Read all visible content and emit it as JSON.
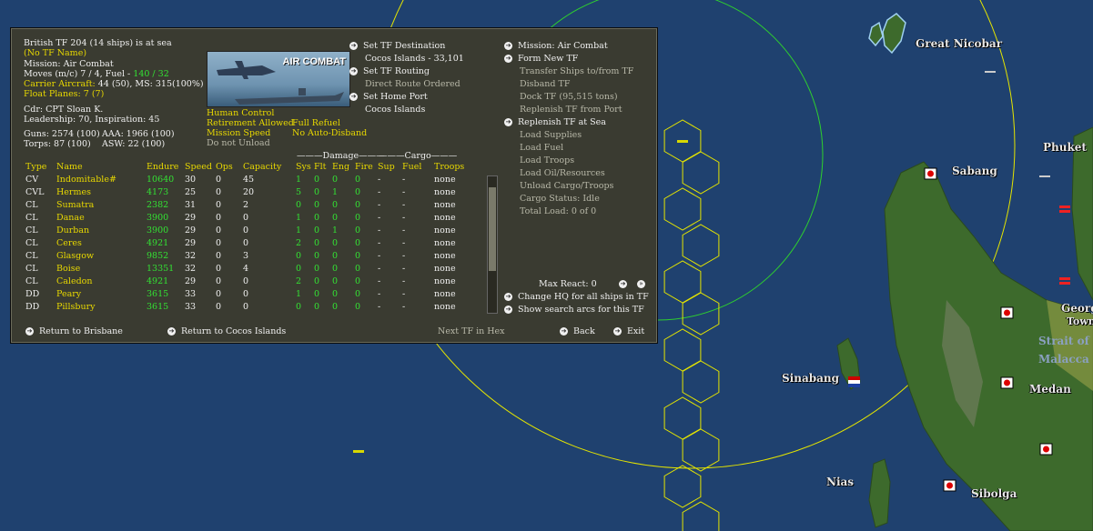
{
  "map": {
    "labels": {
      "great_nicobar": "Great Nicobar",
      "phuket": "Phuket",
      "sabang": "Sabang",
      "sinabang": "Sinabang",
      "medan": "Medan",
      "nias": "Nias",
      "sibolga": "Sibolga",
      "strait_line1": "Strait of",
      "strait_line2": "Malacca",
      "george_line1": "Georg",
      "george_line2": "Town"
    }
  },
  "panel": {
    "header": {
      "title": "British TF 204 (14 ships) is at sea",
      "tf_name": "(No TF Name)",
      "mission": "Mission:  Air Combat",
      "moves_prefix": "Moves (m/c)  7 / 4, Fuel - ",
      "fuel": "140 / 32",
      "carrier_label": "Carrier Aircraft:",
      "carrier_value": " 44 (50),  MS: 315(100%)",
      "float_label": "Float Planes:",
      "float_value": " 7 (7)",
      "cdr": "Cdr: CPT  Sloan K.",
      "leadership": "Leadership: 70, Inspiration: 45",
      "guns": "Guns: 2574 (100)",
      "aaa": "AAA: 1966 (100)",
      "torps": "Torps: 87 (100)",
      "asw": "ASW: 22 (100)"
    },
    "image_caption": "AIR COMBAT",
    "options": {
      "human_control": "Human Control",
      "retirement": "Retirement Allowed",
      "full_refuel": "Full Refuel",
      "mission_speed": "Mission Speed",
      "no_auto_disband": "No Auto-Disband",
      "do_not_unload": "Do not Unload"
    },
    "mid_menu": {
      "set_destination": "Set TF Destination",
      "destination_value": "Cocos Islands - 33,101",
      "set_routing": "Set TF Routing",
      "direct_route": "Direct Route Ordered",
      "set_home_port": "Set Home Port",
      "home_port_value": "Cocos Islands"
    },
    "right_menu": {
      "mission": "Mission: Air Combat",
      "form_new": "Form New TF",
      "transfer": "Transfer Ships to/from TF",
      "disband": "Disband TF",
      "dock": "Dock TF (95,515 tons)",
      "replenish_port": "Replenish TF from Port",
      "replenish_sea": "Replenish TF at Sea",
      "load_supplies": "Load Supplies",
      "load_fuel": "Load Fuel",
      "load_troops": "Load Troops",
      "load_oil": "Load Oil/Resources",
      "unload": "Unload Cargo/Troops",
      "cargo_status": "Cargo Status: Idle",
      "total_load": "Total Load: 0 of 0",
      "max_react": "Max React: 0",
      "change_hq": "Change HQ for all ships in TF",
      "show_arcs": "Show search arcs for this TF"
    },
    "table": {
      "group_damage": "———Damage———",
      "group_cargo": "———Cargo———",
      "headers": [
        "Type",
        "Name",
        "Endure",
        "Speed",
        "Ops",
        "Capacity",
        "Sys",
        "Flt",
        "Eng",
        "Fire",
        "Sup",
        "Fuel",
        "Troops"
      ],
      "rows": [
        [
          "CV",
          "Indomitable#",
          "10640",
          "30",
          "0",
          "45",
          "1",
          "0",
          "0",
          "0",
          "-",
          "-",
          "none"
        ],
        [
          "CVL",
          "Hermes",
          "4173",
          "25",
          "0",
          "20",
          "5",
          "0",
          "1",
          "0",
          "-",
          "-",
          "none"
        ],
        [
          "CL",
          "Sumatra",
          "2382",
          "31",
          "0",
          "2",
          "0",
          "0",
          "0",
          "0",
          "-",
          "-",
          "none"
        ],
        [
          "CL",
          "Danae",
          "3900",
          "29",
          "0",
          "0",
          "1",
          "0",
          "0",
          "0",
          "-",
          "-",
          "none"
        ],
        [
          "CL",
          "Durban",
          "3900",
          "29",
          "0",
          "0",
          "1",
          "0",
          "1",
          "0",
          "-",
          "-",
          "none"
        ],
        [
          "CL",
          "Ceres",
          "4921",
          "29",
          "0",
          "0",
          "2",
          "0",
          "0",
          "0",
          "-",
          "-",
          "none"
        ],
        [
          "CL",
          "Glasgow",
          "9852",
          "32",
          "0",
          "3",
          "0",
          "0",
          "0",
          "0",
          "-",
          "-",
          "none"
        ],
        [
          "CL",
          "Boise",
          "13351",
          "32",
          "0",
          "4",
          "0",
          "0",
          "0",
          "0",
          "-",
          "-",
          "none"
        ],
        [
          "CL",
          "Caledon",
          "4921",
          "29",
          "0",
          "0",
          "2",
          "0",
          "0",
          "0",
          "-",
          "-",
          "none"
        ],
        [
          "DD",
          "Peary",
          "3615",
          "33",
          "0",
          "0",
          "1",
          "0",
          "0",
          "0",
          "-",
          "-",
          "none"
        ],
        [
          "DD",
          "Pillsbury",
          "3615",
          "33",
          "0",
          "0",
          "0",
          "0",
          "0",
          "0",
          "-",
          "-",
          "none"
        ]
      ]
    },
    "bottom": {
      "return_brisbane": "Return to Brisbane",
      "return_cocos": "Return to Cocos Islands",
      "next_tf": "Next TF in Hex",
      "back": "Back",
      "exit": "Exit"
    }
  }
}
